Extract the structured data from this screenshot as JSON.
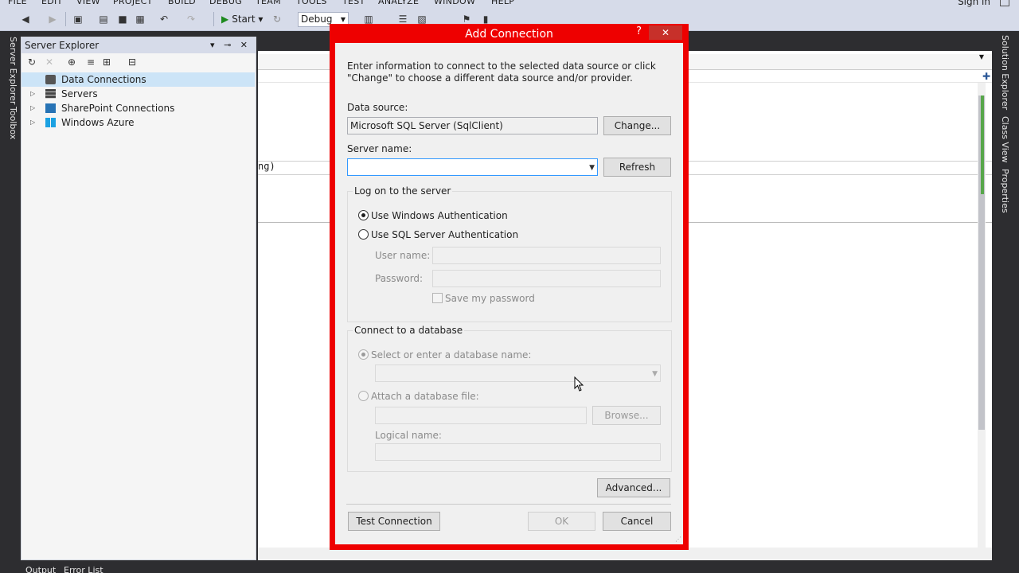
{
  "menu": [
    "FILE",
    "EDIT",
    "VIEW",
    "PROJECT",
    "BUILD",
    "DEBUG",
    "TEAM",
    "TOOLS",
    "TEST",
    "ANALYZE",
    "WINDOW",
    "HELP"
  ],
  "signin": "Sign in",
  "toolbar": {
    "start_label": "Start",
    "config_value": "Debug"
  },
  "left_tabs": [
    "Server Explorer",
    "Toolbox"
  ],
  "right_tabs": [
    "Solution Explorer",
    "Class View",
    "Properties"
  ],
  "server_explorer": {
    "title": "Server Explorer",
    "items": [
      {
        "label": "Data Connections",
        "icon": "database-icon",
        "selected": true
      },
      {
        "label": "Servers",
        "icon": "server-icon"
      },
      {
        "label": "SharePoint Connections",
        "icon": "sharepoint-icon"
      },
      {
        "label": "Windows Azure",
        "icon": "windows-icon"
      }
    ]
  },
  "editor": {
    "code_fragment": "ng)"
  },
  "bottom_tabs": [
    "Output",
    "Error List"
  ],
  "dialog": {
    "title": "Add Connection",
    "help": "?",
    "close": "✕",
    "intro": "Enter information to connect to the selected data source or click \"Change\" to choose a different data source and/or provider.",
    "data_source_label": "Data source:",
    "data_source_value": "Microsoft SQL Server (SqlClient)",
    "change_button": "Change...",
    "server_name_label": "Server name:",
    "server_name_value": "",
    "refresh_button": "Refresh",
    "logon_group": "Log on to the server",
    "auth_windows": "Use Windows Authentication",
    "auth_sql": "Use SQL Server Authentication",
    "user_name_label": "User name:",
    "password_label": "Password:",
    "save_password": "Save my password",
    "db_group": "Connect to a database",
    "select_db": "Select or enter a database name:",
    "attach_db": "Attach a database file:",
    "browse_button": "Browse...",
    "logical_name_label": "Logical name:",
    "advanced_button": "Advanced...",
    "test_button": "Test Connection",
    "ok_button": "OK",
    "cancel_button": "Cancel"
  },
  "colors": {
    "highlight_border": "#ee0000",
    "selection": "#cce4f7"
  }
}
